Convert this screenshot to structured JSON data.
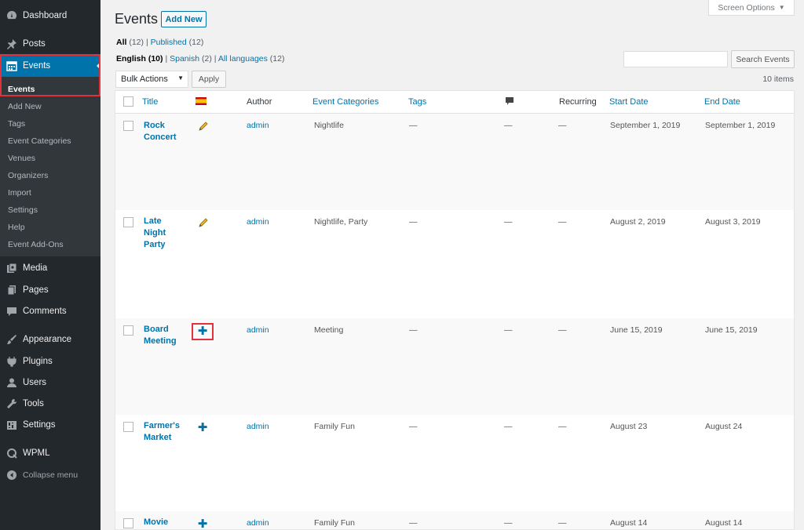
{
  "sidebar": {
    "menu": [
      {
        "label": "Dashboard",
        "icon": "dashboard-icon"
      },
      {
        "label": "Posts",
        "icon": "pin-icon"
      },
      {
        "label": "Events",
        "icon": "calendar-icon"
      },
      {
        "label": "Media",
        "icon": "media-icon"
      },
      {
        "label": "Pages",
        "icon": "pages-icon"
      },
      {
        "label": "Comments",
        "icon": "comment-icon"
      },
      {
        "label": "Appearance",
        "icon": "brush-icon"
      },
      {
        "label": "Plugins",
        "icon": "plug-icon"
      },
      {
        "label": "Users",
        "icon": "user-icon"
      },
      {
        "label": "Tools",
        "icon": "wrench-icon"
      },
      {
        "label": "Settings",
        "icon": "settings-icon"
      },
      {
        "label": "WPML",
        "icon": "wpml-icon"
      },
      {
        "label": "Collapse menu",
        "icon": "collapse-icon"
      }
    ],
    "submenu": [
      "Events",
      "Add New",
      "Tags",
      "Event Categories",
      "Venues",
      "Organizers",
      "Import",
      "Settings",
      "Help",
      "Event Add-Ons"
    ]
  },
  "header": {
    "title": "Events",
    "add_new": "Add New",
    "screen_options": "Screen Options"
  },
  "filters": {
    "all": "All",
    "all_count": "(12)",
    "published": "Published",
    "published_count": "(12)",
    "english": "English",
    "english_count": "(10)",
    "spanish": "Spanish",
    "spanish_count": "(2)",
    "all_languages": "All languages",
    "all_languages_count": "(12)"
  },
  "search_button": "Search Events",
  "bulk_actions": "Bulk Actions",
  "apply": "Apply",
  "items_count": "10 items",
  "columns": {
    "title": "Title",
    "author": "Author",
    "categories": "Event Categories",
    "tags": "Tags",
    "recurring": "Recurring",
    "start": "Start Date",
    "end": "End Date"
  },
  "rows": [
    {
      "title": "Rock Concert",
      "lang": "pencil",
      "author": "admin",
      "categories": "Nightlife",
      "tags": "—",
      "comments": "—",
      "recurring": "—",
      "start": "September 1, 2019",
      "end": "September 1, 2019"
    },
    {
      "title": "Late Night Party",
      "lang": "pencil",
      "author": "admin",
      "categories": "Nightlife, Party",
      "tags": "—",
      "comments": "—",
      "recurring": "—",
      "start": "August 2, 2019",
      "end": "August 3, 2019"
    },
    {
      "title": "Board Meeting",
      "lang": "plus",
      "author": "admin",
      "categories": "Meeting",
      "tags": "—",
      "comments": "—",
      "recurring": "—",
      "start": "June 15, 2019",
      "end": "June 15, 2019"
    },
    {
      "title": "Farmer's Market",
      "lang": "plus",
      "author": "admin",
      "categories": "Family Fun",
      "tags": "—",
      "comments": "—",
      "recurring": "—",
      "start": "August 23",
      "end": "August 24"
    },
    {
      "title": "Movie",
      "lang": "plus",
      "author": "admin",
      "categories": "Family Fun",
      "tags": "—",
      "comments": "—",
      "recurring": "—",
      "start": "August 14",
      "end": "August 14"
    }
  ],
  "colors": {
    "admin_bar": "#23282d",
    "accent": "#0073aa",
    "highlight_box": "#e0323c"
  }
}
